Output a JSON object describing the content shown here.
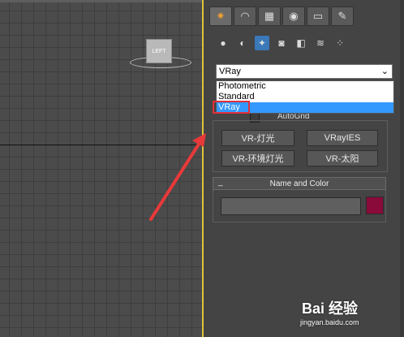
{
  "viewport": {
    "viewcube_label": "LEFT"
  },
  "panel": {
    "tabs": [
      {
        "icon": "create-icon",
        "glyph": "✷"
      },
      {
        "icon": "modify-icon",
        "glyph": "◠"
      },
      {
        "icon": "hierarchy-icon",
        "glyph": "▦"
      },
      {
        "icon": "motion-icon",
        "glyph": "◉"
      },
      {
        "icon": "display-icon",
        "glyph": "▭"
      },
      {
        "icon": "utilities-icon",
        "glyph": "✎"
      }
    ],
    "subcategories": [
      {
        "icon": "geometry-icon",
        "glyph": "●"
      },
      {
        "icon": "shapes-icon",
        "glyph": "◐"
      },
      {
        "icon": "lights-icon",
        "glyph": "✦"
      },
      {
        "icon": "cameras-icon",
        "glyph": "◙"
      },
      {
        "icon": "helpers-icon",
        "glyph": "◧"
      },
      {
        "icon": "spacewarps-icon",
        "glyph": "≋"
      },
      {
        "icon": "systems-icon",
        "glyph": "⁘"
      }
    ],
    "category_combo": {
      "value": "VRay"
    },
    "dropdown_options": [
      {
        "label": "Photometric"
      },
      {
        "label": "Standard"
      },
      {
        "label": "VRay"
      }
    ],
    "autogrid_label": "AutoGrid",
    "object_buttons": [
      "VR-灯光",
      "VRayIES",
      "VR-环境灯光",
      "VR-太阳"
    ],
    "name_color": {
      "collapse_symbol": "_",
      "title": "Name and Color",
      "swatch_color": "#8a0a3a"
    }
  },
  "watermark": {
    "logo": "Bai 经验",
    "url": "jingyan.baidu.com"
  }
}
